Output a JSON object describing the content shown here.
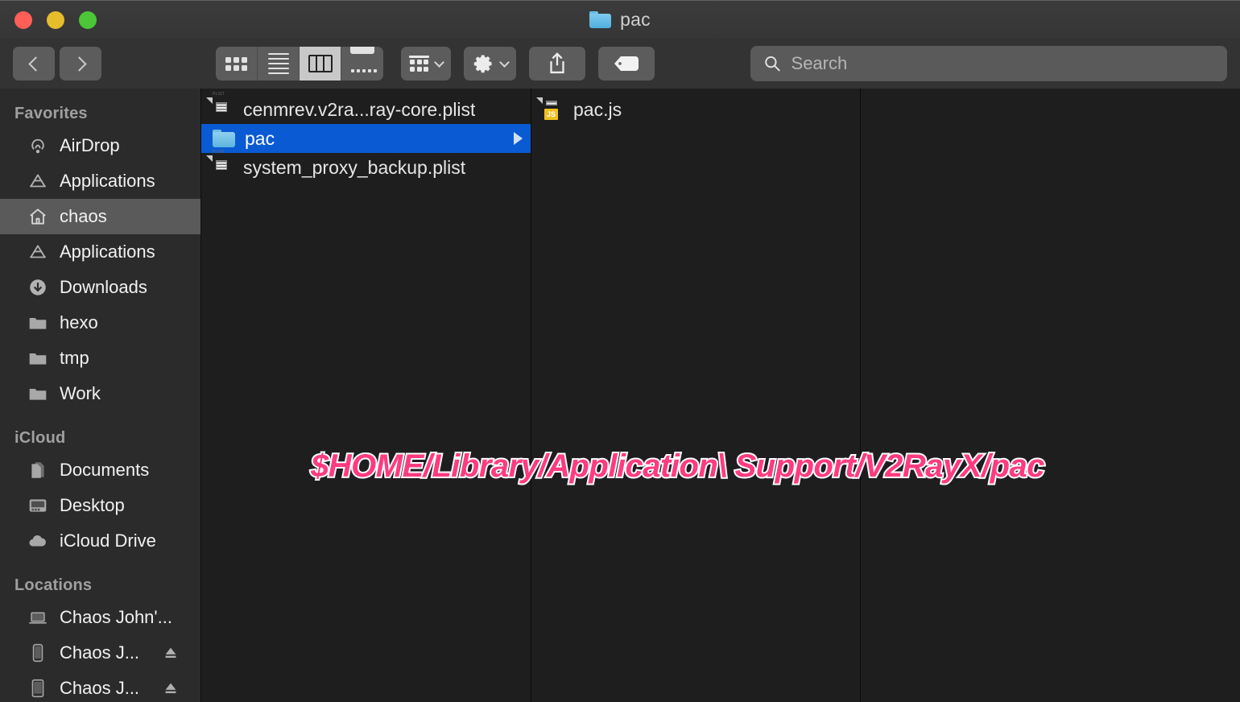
{
  "window": {
    "title": "pac",
    "title_icon": "folder-icon",
    "traffic_lights": [
      {
        "name": "close-button",
        "color": "#ff5f57"
      },
      {
        "name": "minimize-button",
        "color": "#e5bd2d"
      },
      {
        "name": "maximize-button",
        "color": "#4cc637"
      }
    ]
  },
  "toolbar": {
    "back_label": "Back",
    "forward_label": "Forward",
    "view_modes": [
      {
        "id": "icon-view",
        "label": "Icon View",
        "selected": false
      },
      {
        "id": "list-view",
        "label": "List View",
        "selected": false
      },
      {
        "id": "column-view",
        "label": "Column View",
        "selected": true
      },
      {
        "id": "gallery-view",
        "label": "Gallery View",
        "selected": false
      }
    ],
    "group_label": "Group",
    "action_label": "Action",
    "share_label": "Share",
    "tags_label": "Tags"
  },
  "search": {
    "placeholder": "Search",
    "value": ""
  },
  "sidebar": {
    "sections": [
      {
        "title": "Favorites",
        "items": [
          {
            "label": "AirDrop",
            "icon": "airdrop-icon",
            "selected": false,
            "ejectable": false
          },
          {
            "label": "Applications",
            "icon": "applications-icon",
            "selected": false,
            "ejectable": false
          },
          {
            "label": "chaos",
            "icon": "home-icon",
            "selected": true,
            "ejectable": false
          },
          {
            "label": "Applications",
            "icon": "applications-icon",
            "selected": false,
            "ejectable": false
          },
          {
            "label": "Downloads",
            "icon": "downloads-icon",
            "selected": false,
            "ejectable": false
          },
          {
            "label": "hexo",
            "icon": "folder-icon",
            "selected": false,
            "ejectable": false
          },
          {
            "label": "tmp",
            "icon": "folder-icon",
            "selected": false,
            "ejectable": false
          },
          {
            "label": "Work",
            "icon": "folder-icon",
            "selected": false,
            "ejectable": false
          }
        ]
      },
      {
        "title": "iCloud",
        "items": [
          {
            "label": "Documents",
            "icon": "documents-icon",
            "selected": false,
            "ejectable": false
          },
          {
            "label": "Desktop",
            "icon": "desktop-icon",
            "selected": false,
            "ejectable": false
          },
          {
            "label": "iCloud Drive",
            "icon": "cloud-icon",
            "selected": false,
            "ejectable": false
          }
        ]
      },
      {
        "title": "Locations",
        "items": [
          {
            "label": "Chaos John'...",
            "icon": "laptop-icon",
            "selected": false,
            "ejectable": false
          },
          {
            "label": "Chaos J...",
            "icon": "iphone-icon",
            "selected": false,
            "ejectable": true
          },
          {
            "label": "Chaos J...",
            "icon": "ipad-icon",
            "selected": false,
            "ejectable": true
          }
        ]
      }
    ]
  },
  "columns": [
    {
      "id": "column-1",
      "rows": [
        {
          "label": "cenmrev.v2ra...ray-core.plist",
          "icon": "plist-file-icon",
          "selected": false,
          "has_children": false
        },
        {
          "label": "pac",
          "icon": "folder-icon",
          "selected": true,
          "has_children": true
        },
        {
          "label": "system_proxy_backup.plist",
          "icon": "plist-file-icon",
          "selected": false,
          "has_children": false
        }
      ]
    },
    {
      "id": "column-2",
      "rows": [
        {
          "label": "pac.js",
          "icon": "js-file-icon",
          "selected": false,
          "has_children": false
        }
      ]
    },
    {
      "id": "column-3",
      "rows": []
    }
  ],
  "annotation": {
    "path_text": "$HOME/Library/Application\\ Support/V2RayX/pac",
    "color": "#ff3b7f",
    "outline_color": "#ffffff"
  }
}
